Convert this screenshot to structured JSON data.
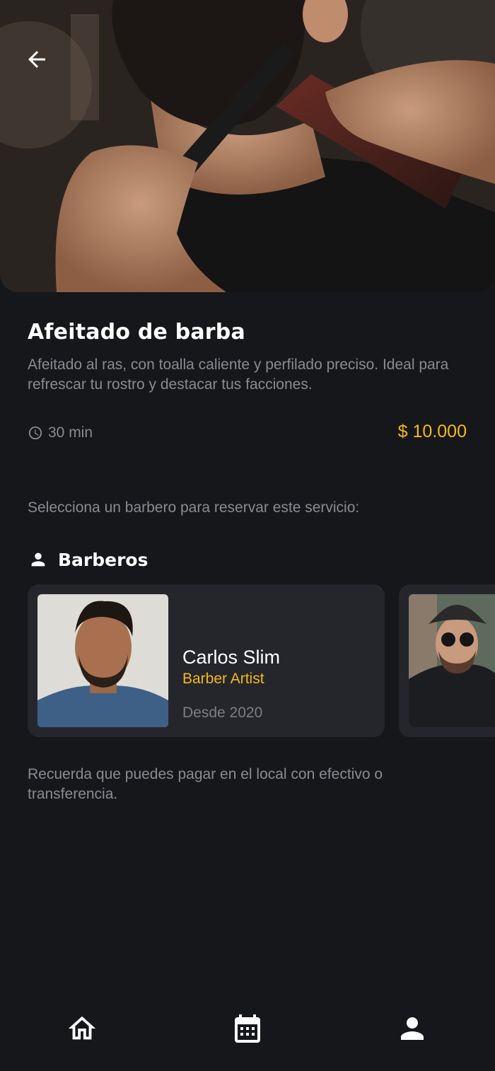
{
  "service": {
    "title": "Afeitado de barba",
    "description": "Afeitado al ras, con toalla caliente y perfilado preciso. Ideal para refrescar tu rostro y destacar tus facciones.",
    "duration": "30 min",
    "price": "$ 10.000"
  },
  "select_hint": "Selecciona un barbero para reservar este servicio:",
  "barbers_section": {
    "title": "Barberos",
    "items": [
      {
        "name": "Carlos Slim",
        "role": "Barber Artist",
        "since": "Desde 2020"
      }
    ]
  },
  "payment_note": "Recuerda que puedes pagar en el local con efectivo o transferencia.",
  "icons": {
    "back": "arrow-left-icon",
    "duration": "clock-icon",
    "barbers": "person-icon",
    "nav": [
      "home-icon",
      "calendar-icon",
      "profile-icon"
    ]
  },
  "colors": {
    "background": "#16171b",
    "card": "#25262c",
    "accent": "#f5b914",
    "muted_text": "#8a8b90"
  }
}
